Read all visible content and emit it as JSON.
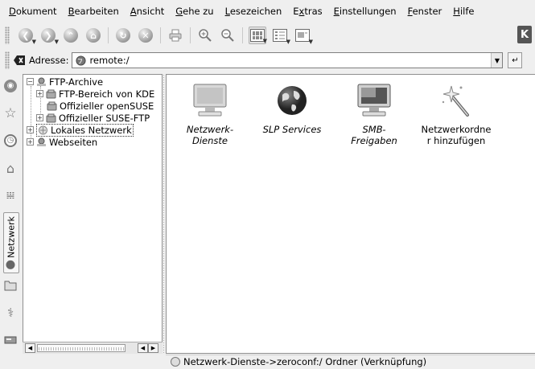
{
  "menubar": {
    "items": [
      {
        "label": "Dokument"
      },
      {
        "label": "Bearbeiten"
      },
      {
        "label": "Ansicht"
      },
      {
        "label": "Gehe zu"
      },
      {
        "label": "Lesezeichen"
      },
      {
        "label": "Extras"
      },
      {
        "label": "Einstellungen"
      },
      {
        "label": "Fenster"
      },
      {
        "label": "Hilfe"
      }
    ]
  },
  "toolbar": {
    "buttons": [
      "back-icon",
      "forward-icon",
      "up-icon",
      "home-icon",
      "reload-icon",
      "stop-icon",
      "print-icon",
      "zoom-in-icon",
      "zoom-out-icon",
      "icon-view-icon",
      "detail-view-icon",
      "preview-view-icon"
    ],
    "throbber_glyph": "K"
  },
  "location": {
    "label": "Adresse:",
    "value": "remote:/"
  },
  "sidebar_tabs": {
    "active_label": "Netzwerk"
  },
  "tree": {
    "root": "FTP-Archive",
    "children": [
      "FTP-Bereich von KDE",
      "Offizieller openSUSE",
      "Offizieller SUSE-FTP"
    ],
    "local_network": "Lokales Netzwerk",
    "websites": "Webseiten"
  },
  "main": {
    "items": [
      {
        "label": "Netzwerk-\nDienste",
        "italic": true,
        "icon": "monitor-icon"
      },
      {
        "label": "SLP Services",
        "italic": true,
        "icon": "globe-icon"
      },
      {
        "label": "SMB-\nFreigaben",
        "italic": true,
        "icon": "monitor-icon"
      },
      {
        "label": "Netzwerkordne\nr hinzufügen",
        "italic": false,
        "icon": "magic-wand-icon"
      }
    ]
  },
  "status": {
    "text": "Netzwerk-Dienste->zeroconf:/  Ordner (Verknüpfung)"
  }
}
